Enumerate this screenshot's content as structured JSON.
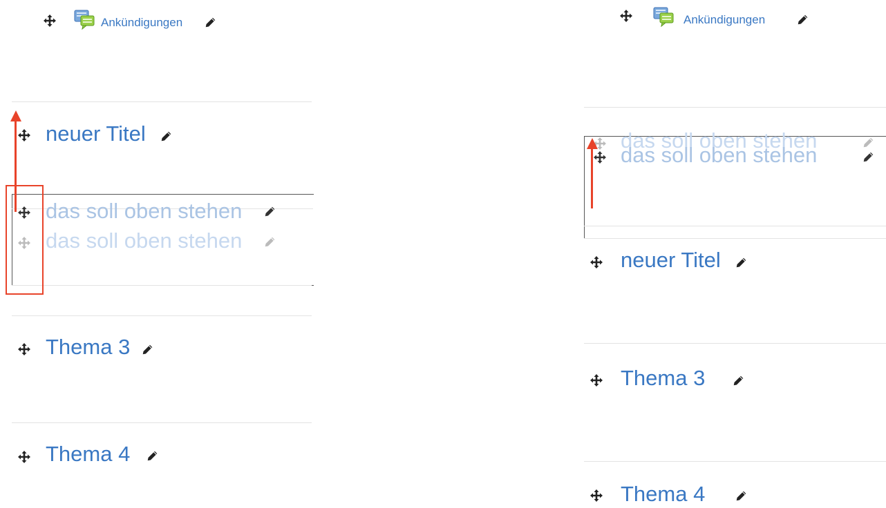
{
  "announcements": {
    "label": "Ankündigungen"
  },
  "sections": {
    "new_title": "neuer Titel",
    "dragged": "das soll oben stehen",
    "topic3": "Thema 3",
    "topic4": "Thema 4"
  },
  "icons": {
    "move": "move-icon",
    "edit": "pencil-icon",
    "forum": "forum-icon"
  },
  "colors": {
    "link": "#3a78c3",
    "annotation": "#e8432a"
  }
}
